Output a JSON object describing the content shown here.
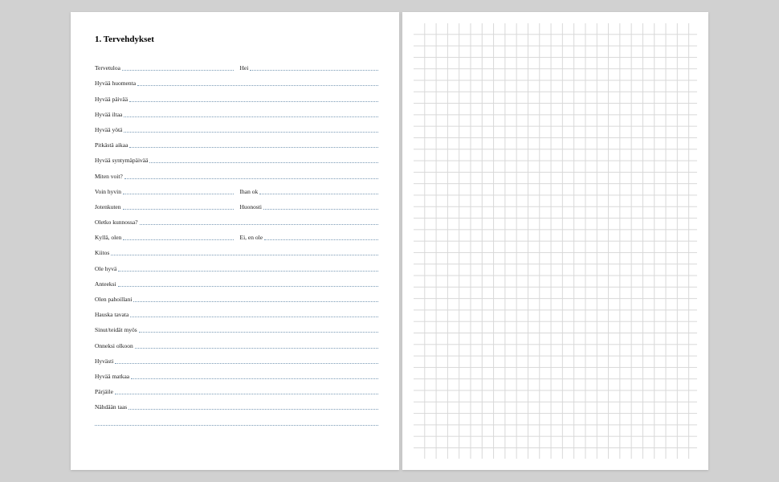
{
  "heading": "1. Tervehdykset",
  "rows": [
    {
      "type": "double",
      "a": "Tervetuloa",
      "b": "Hei"
    },
    {
      "type": "single",
      "a": "Hyvää huomenta"
    },
    {
      "type": "single",
      "a": "Hyvää päivää"
    },
    {
      "type": "single",
      "a": "Hyvää iltaa"
    },
    {
      "type": "single",
      "a": "Hyvää yötä"
    },
    {
      "type": "single",
      "a": "Pitkästä aikaa"
    },
    {
      "type": "single",
      "a": "Hyvää syntymäpäivää"
    },
    {
      "type": "single",
      "a": "Miten voit?"
    },
    {
      "type": "double",
      "a": "Voin hyvin",
      "b": "Ihan ok"
    },
    {
      "type": "double",
      "a": "Jotenkuten",
      "b": "Huonosti"
    },
    {
      "type": "single",
      "a": "Oletko kunnossa?"
    },
    {
      "type": "double",
      "a": "Kyllä, olen",
      "b": "Ei, en ole"
    },
    {
      "type": "single",
      "a": "Kiitos"
    },
    {
      "type": "single",
      "a": "Ole hyvä"
    },
    {
      "type": "single",
      "a": "Anteeksi"
    },
    {
      "type": "single",
      "a": "Olen pahoillani"
    },
    {
      "type": "single",
      "a": "Hauska tavata"
    },
    {
      "type": "single",
      "a": "Sinut/teidät myös"
    },
    {
      "type": "single",
      "a": "Onneksi olkoon"
    },
    {
      "type": "single",
      "a": "Hyvästi"
    },
    {
      "type": "single",
      "a": "Hyvää matkaa"
    },
    {
      "type": "single",
      "a": "Pärjäile"
    },
    {
      "type": "single",
      "a": "Nähdään taas"
    },
    {
      "type": "empty"
    }
  ]
}
